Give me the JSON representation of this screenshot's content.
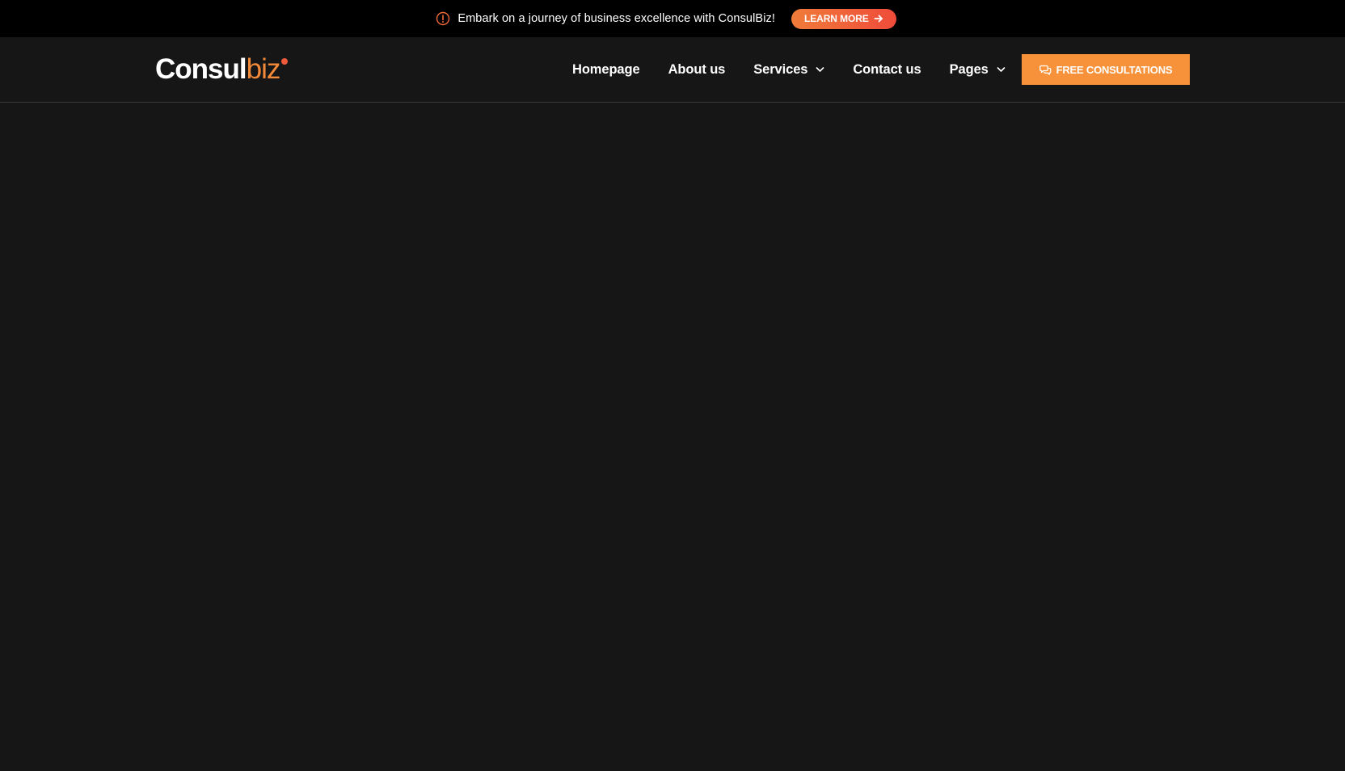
{
  "announcement": {
    "icon": "info-circle-icon",
    "text": "Embark on a journey of business excellence with ConsulBiz!",
    "button_label": "LEARN MORE",
    "button_icon": "arrow-right-icon",
    "accent_gradient": [
      "#f07c3a",
      "#ef4b3a"
    ]
  },
  "header": {
    "logo": {
      "part_a": "Consul",
      "part_b": "biz",
      "accent_color": "#f28a3a"
    },
    "nav": [
      {
        "label": "Homepage",
        "has_dropdown": false
      },
      {
        "label": "About us",
        "has_dropdown": false
      },
      {
        "label": "Services",
        "has_dropdown": true
      },
      {
        "label": "Contact us",
        "has_dropdown": false
      },
      {
        "label": "Pages",
        "has_dropdown": true
      }
    ],
    "cta_label": "FREE CONSULTATIONS",
    "cta_icon": "chat-bubbles-icon",
    "cta_color": "#f8923a"
  },
  "colors": {
    "top_bar_bg": "#000000",
    "page_bg": "#161616",
    "text": "#ffffff"
  }
}
